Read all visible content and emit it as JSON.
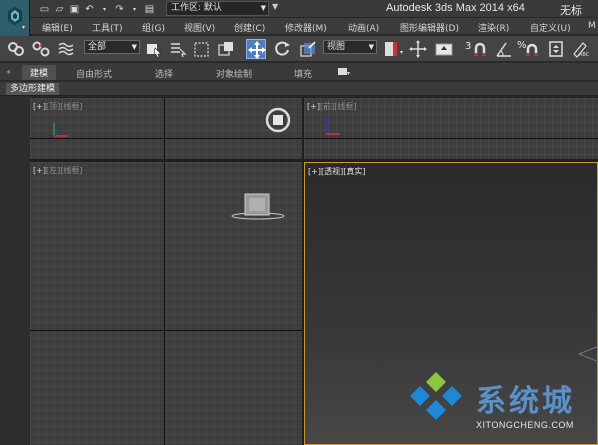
{
  "titlebar": {
    "title": "Autodesk 3ds Max  2014 x64",
    "title_extra": "无标",
    "workspace_label": "工作区: 默认"
  },
  "menu": [
    "编辑(E)",
    "工具(T)",
    "组(G)",
    "视图(V)",
    "创建(C)",
    "修改器(M)",
    "动画(A)",
    "图形编辑器(D)",
    "渲染(R)",
    "自定义(U)",
    "M"
  ],
  "toolbar": {
    "selection_filter": "全部",
    "reference_coord": "视图",
    "snap_number": "3",
    "percent_symbol": "%",
    "abc_label": "ABC"
  },
  "ribbon": {
    "tabs": [
      "建模",
      "自由形式",
      "选择",
      "对象绘制",
      "填充"
    ],
    "active_tab": "建模",
    "subpanel": "多边形建模"
  },
  "viewports": {
    "top": {
      "plus": "[+]",
      "name": "[顶]",
      "mode": "[线框]"
    },
    "front": {
      "plus": "[+]",
      "name": "[前]",
      "mode": "[线框]"
    },
    "left": {
      "plus": "[+]",
      "name": "[左]",
      "mode": "[线框]"
    },
    "perspective": {
      "plus": "[+]",
      "name": "[透视]",
      "mode": "[真实]"
    }
  },
  "watermark": {
    "brand": "系统城",
    "url": "XITONGCHENG.COM",
    "color_blue": "#5b91c8",
    "color_green": "#8cc63f"
  },
  "colors": {
    "active_viewport_border": "#c89a2e",
    "active_tool": "#4f7fbf"
  }
}
